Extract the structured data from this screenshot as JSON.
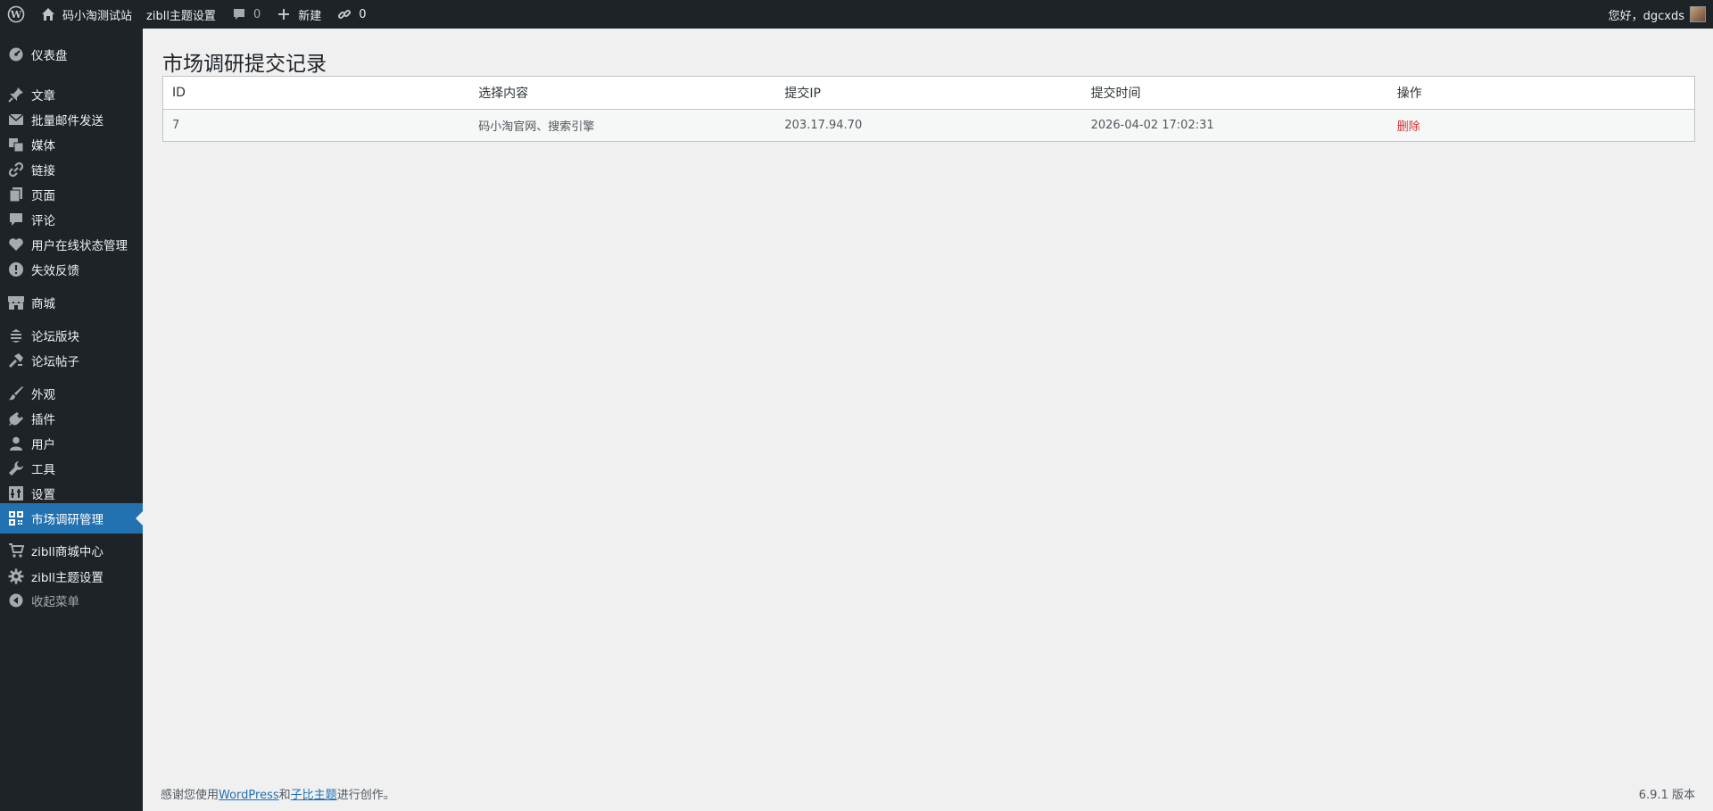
{
  "adminbar": {
    "site_name": "码小淘测试站",
    "theme_settings": "zibll主题设置",
    "comments_count": "0",
    "new_label": "新建",
    "links_count": "0",
    "greeting": "您好，dgcxds"
  },
  "sidebar": {
    "items": [
      {
        "label": "仪表盘",
        "icon": "dashboard-icon"
      },
      {
        "label": "文章",
        "icon": "pin-icon"
      },
      {
        "label": "批量邮件发送",
        "icon": "email-icon"
      },
      {
        "label": "媒体",
        "icon": "media-icon"
      },
      {
        "label": "链接",
        "icon": "link-icon"
      },
      {
        "label": "页面",
        "icon": "page-icon"
      },
      {
        "label": "评论",
        "icon": "comment-icon"
      },
      {
        "label": "用户在线状态管理",
        "icon": "heart-icon"
      },
      {
        "label": "失效反馈",
        "icon": "warning-icon"
      },
      {
        "label": "商城",
        "icon": "store-icon"
      },
      {
        "label": "论坛版块",
        "icon": "forum-icon"
      },
      {
        "label": "论坛帖子",
        "icon": "hammer-icon"
      },
      {
        "label": "外观",
        "icon": "brush-icon"
      },
      {
        "label": "插件",
        "icon": "plugin-icon"
      },
      {
        "label": "用户",
        "icon": "user-icon"
      },
      {
        "label": "工具",
        "icon": "wrench-icon"
      },
      {
        "label": "设置",
        "icon": "settings-icon"
      },
      {
        "label": "市场调研管理",
        "icon": "grid-icon"
      },
      {
        "label": "zibll商城中心",
        "icon": "cart-icon"
      },
      {
        "label": "zibll主题设置",
        "icon": "gear-icon"
      },
      {
        "label": "收起菜单",
        "icon": "collapse-icon"
      }
    ]
  },
  "page": {
    "title": "市场调研提交记录"
  },
  "table": {
    "headers": [
      "ID",
      "选择内容",
      "提交IP",
      "提交时间",
      "操作"
    ],
    "rows": [
      {
        "id": "7",
        "content": "码小淘官网、搜索引擎",
        "ip": "203.17.94.70",
        "time": "2026-04-02 17:02:31",
        "action": "删除"
      }
    ]
  },
  "footer": {
    "text_prefix": "感谢您使用",
    "link_wp": "WordPress",
    "text_and": "和",
    "link_theme": "子比主题",
    "text_suffix": "进行创作。",
    "version": "6.9.1 版本"
  },
  "colors": {
    "adminbar_bg": "#1d2327",
    "active_bg": "#2271b1",
    "delete_link": "#d63638"
  }
}
